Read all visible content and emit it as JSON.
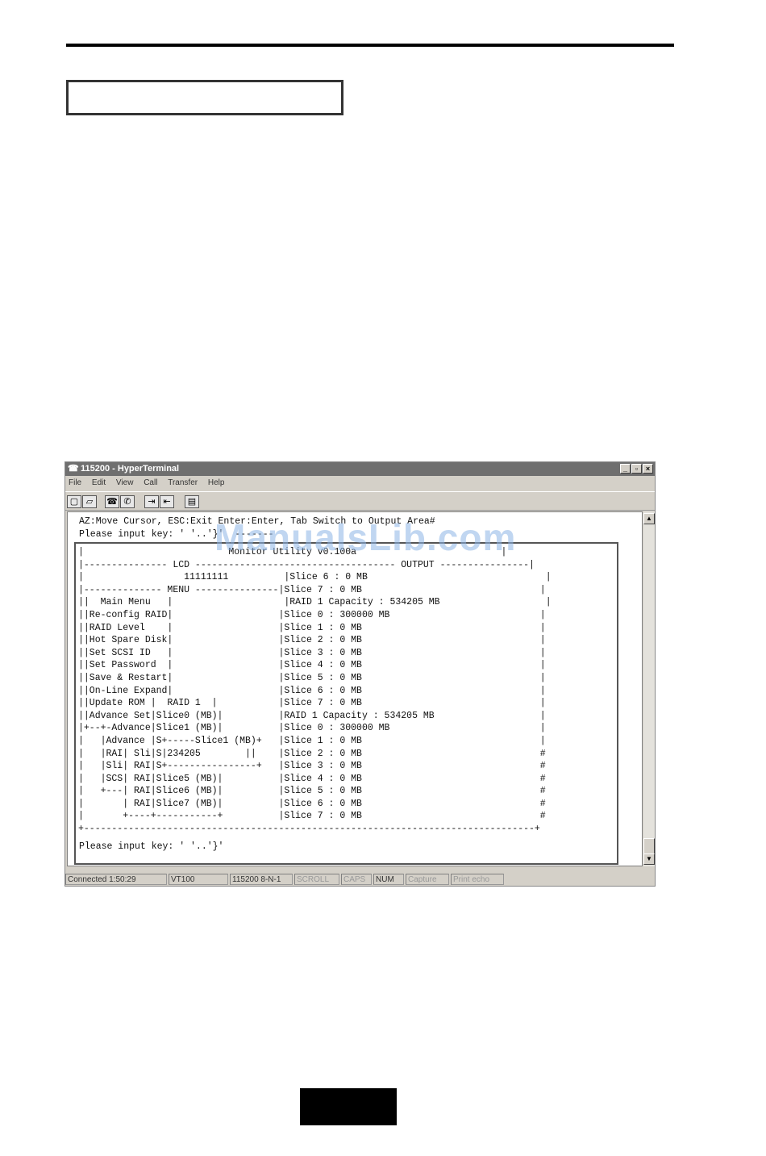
{
  "window": {
    "title": "115200 - HyperTerminal",
    "minimize": "_",
    "maximize": "▫",
    "close": "×"
  },
  "menubar": {
    "items": [
      "File",
      "Edit",
      "View",
      "Call",
      "Transfer",
      "Help"
    ]
  },
  "toolbar": {
    "buttons": [
      "new-connection-icon",
      "open-icon",
      "connect-icon",
      "disconnect-icon",
      "send-icon",
      "receive-icon",
      "properties-icon"
    ]
  },
  "terminal": {
    "header_line_1": "AZ:Move Cursor, ESC:Exit Enter:Enter, Tab Switch to Output Area#",
    "header_line_2": "Please input key: ' '..'}'  -------",
    "dialog_lines": [
      "|                          Monitor Utility v0.100a                          |",
      "|--------------- LCD ------------------------------------ OUTPUT ----------------|",
      "|                  11111111          |Slice 6 : 0 MB                                |",
      "|-------------- MENU ---------------|Slice 7 : 0 MB                                |",
      "||  Main Menu   |                    |RAID 1 Capacity : 534205 MB                   |",
      "||Re-config RAID|                   |Slice 0 : 300000 MB                           |",
      "||RAID Level    |                   |Slice 1 : 0 MB                                |",
      "||Hot Spare Disk|                   |Slice 2 : 0 MB                                |",
      "||Set SCSI ID   |                   |Slice 3 : 0 MB                                |",
      "||Set Password  |                   |Slice 4 : 0 MB                                |",
      "||Save & Restart|                   |Slice 5 : 0 MB                                |",
      "||On-Line Expand|                   |Slice 6 : 0 MB                                |",
      "||Update ROM |  RAID 1  |           |Slice 7 : 0 MB                                |",
      "||Advance Set|Slice0 (MB)|          |RAID 1 Capacity : 534205 MB                   |",
      "|+--+-Advance|Slice1 (MB)|          |Slice 0 : 300000 MB                           |",
      "|   |Advance |S+-----Slice1 (MB)+   |Slice 1 : 0 MB                                |",
      "|   |RAI| Sli|S|234205        ||    |Slice 2 : 0 MB                                #",
      "|   |Sli| RAI|S+----------------+   |Slice 3 : 0 MB                                #",
      "|   |SCS| RAI|Slice5 (MB)|          |Slice 4 : 0 MB                                #",
      "|   +---| RAI|Slice6 (MB)|          |Slice 5 : 0 MB                                #",
      "|       | RAI|Slice7 (MB)|          |Slice 6 : 0 MB                                #",
      "|       +----+-----------+          |Slice 7 : 0 MB                                #",
      "+---------------------------------------------------------------------------------+"
    ],
    "prompt": "Please input key: ' '..'}'"
  },
  "statusbar": {
    "connected": "Connected 1:50:29",
    "emulation": "VT100",
    "settings": "115200 8-N-1",
    "scroll": "SCROLL",
    "caps": "CAPS",
    "num": "NUM",
    "capture": "Capture",
    "print_echo": "Print echo"
  },
  "watermark": "ManualsLib.com"
}
